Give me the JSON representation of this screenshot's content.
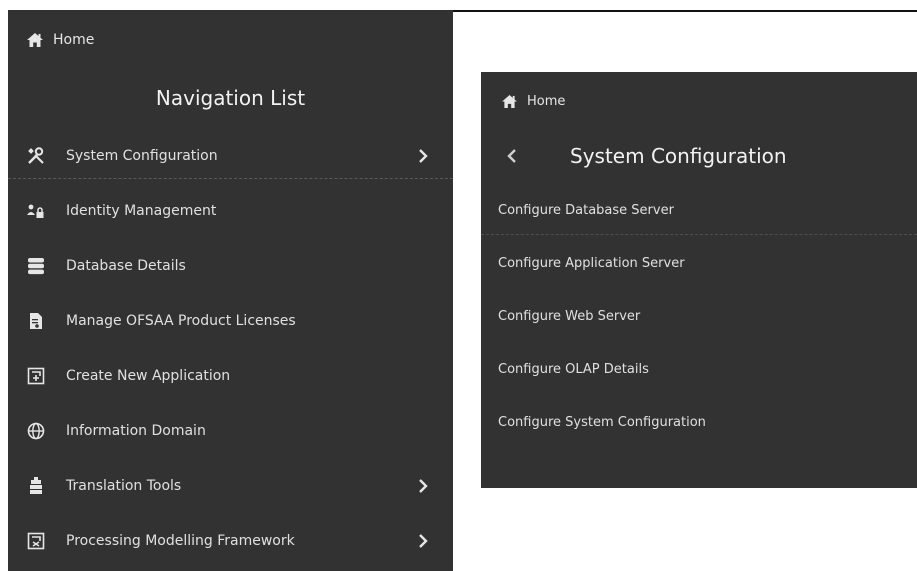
{
  "left_panel": {
    "home_label": "Home",
    "title": "Navigation List",
    "items": [
      {
        "label": "System Configuration",
        "icon": "tools-icon",
        "has_submenu": true
      },
      {
        "label": "Identity Management",
        "icon": "users-lock-icon",
        "has_submenu": false
      },
      {
        "label": "Database Details",
        "icon": "database-icon",
        "has_submenu": false
      },
      {
        "label": "Manage OFSAA Product Licenses",
        "icon": "license-document-icon",
        "has_submenu": false
      },
      {
        "label": "Create New Application",
        "icon": "new-application-icon",
        "has_submenu": false
      },
      {
        "label": "Information Domain",
        "icon": "globe-icon",
        "has_submenu": false
      },
      {
        "label": "Translation Tools",
        "icon": "translation-tools-icon",
        "has_submenu": true
      },
      {
        "label": "Processing Modelling Framework",
        "icon": "processing-framework-icon",
        "has_submenu": true
      }
    ]
  },
  "right_panel": {
    "home_label": "Home",
    "title": "System Configuration",
    "items": [
      {
        "label": "Configure Database Server"
      },
      {
        "label": "Configure Application Server"
      },
      {
        "label": "Configure Web Server"
      },
      {
        "label": "Configure OLAP Details"
      },
      {
        "label": "Configure System Configuration"
      }
    ]
  },
  "colors": {
    "panel_bg": "#323232",
    "text": "#e6e6e6",
    "page_bg": "#ffffff"
  }
}
